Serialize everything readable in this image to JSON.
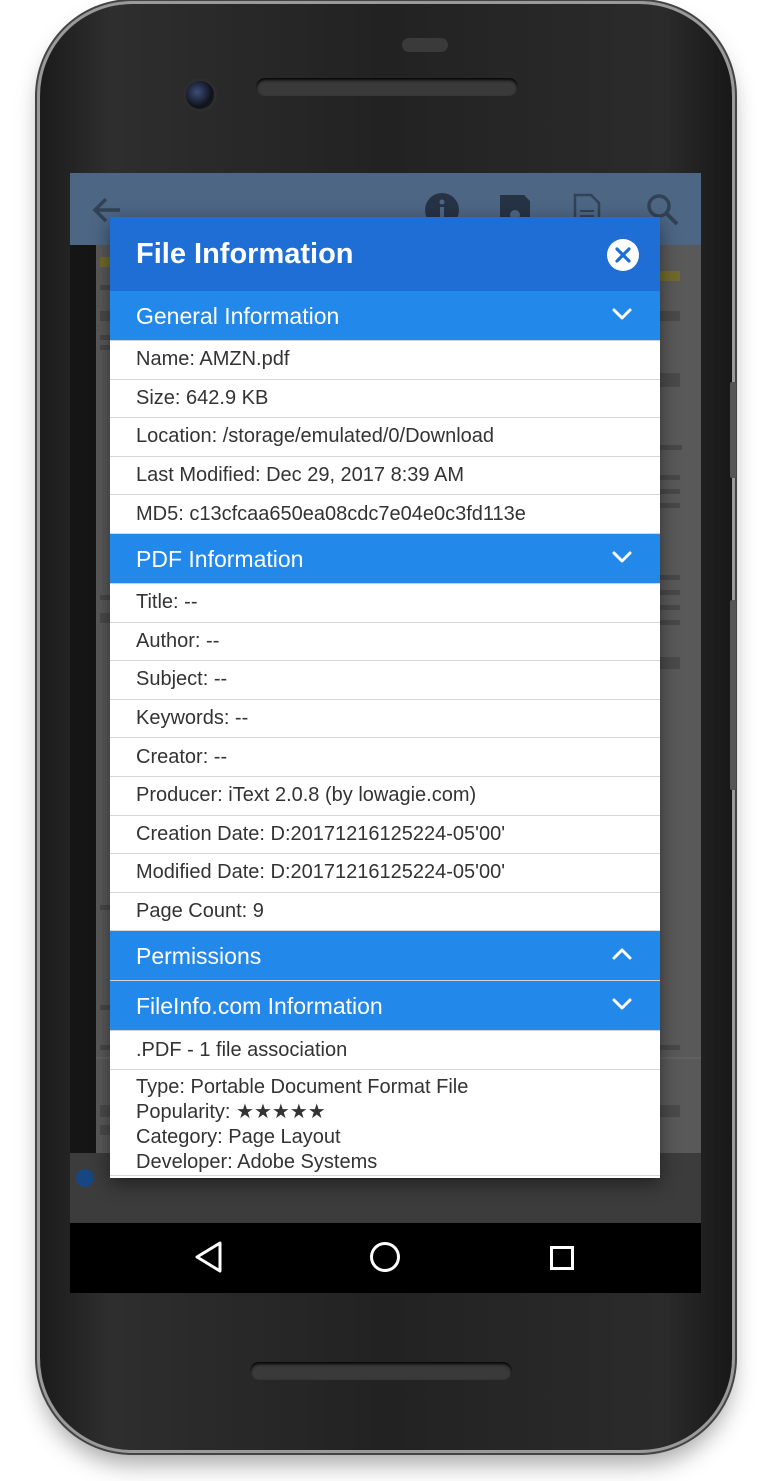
{
  "dialog": {
    "title": "File Information",
    "sections": {
      "general": {
        "label": "General Information",
        "rows": [
          "Name: AMZN.pdf",
          "Size: 642.9 KB",
          "Location: /storage/emulated/0/Download",
          "Last Modified: Dec 29, 2017 8:39 AM",
          "MD5: c13cfcaa650ea08cdc7e04e0c3fd113e"
        ]
      },
      "pdf": {
        "label": "PDF Information",
        "rows": [
          "Title: --",
          "Author: --",
          "Subject: --",
          "Keywords: --",
          "Creator: --",
          "Producer: iText 2.0.8 (by lowagie.com)",
          "Creation Date: D:20171216125224-05'00'",
          "Modified Date: D:20171216125224-05'00'",
          "Page Count: 9"
        ]
      },
      "permissions": {
        "label": "Permissions"
      },
      "fileinfo": {
        "label": "FileInfo.com Information",
        "association": ".PDF - 1 file association",
        "details": [
          "Type: Portable Document Format File",
          "Popularity: ★★★★★",
          "Category: Page Layout",
          "Developer: Adobe Systems"
        ]
      }
    }
  },
  "icons": {
    "close": "close-icon",
    "chevron_down": "chevron-down-icon",
    "chevron_up": "chevron-up-icon",
    "nav_back": "back-triangle-icon",
    "nav_home": "home-circle-icon",
    "nav_recents": "recents-square-icon"
  },
  "colors": {
    "header": "#1e6ed6",
    "section": "#2288e9",
    "text": "#333333"
  }
}
